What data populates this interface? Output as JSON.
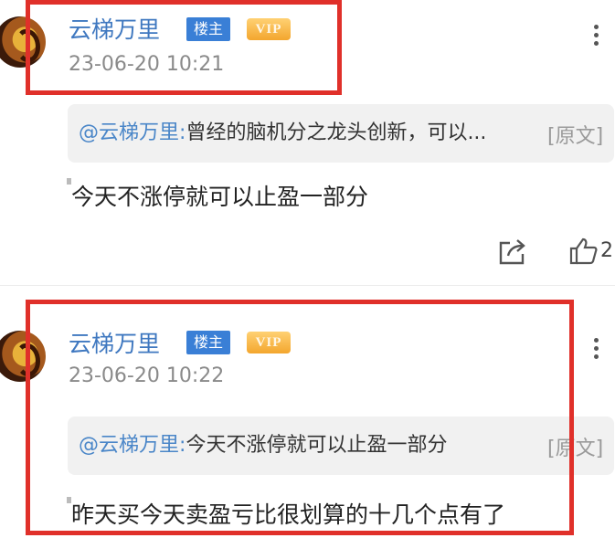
{
  "comments": [
    {
      "username": "云梯万里",
      "owner_tag": "楼主",
      "vip_tag": "VIP",
      "timestamp": "23-06-20 10:21",
      "quote_author": "@云梯万里",
      "quote_colon": ":",
      "quote_text": "曾经的脑机分之龙头创新，可以...",
      "original_label": "[原文]",
      "body": "今天不涨停就可以止盈一部分",
      "like_count": "2"
    },
    {
      "username": "云梯万里",
      "owner_tag": "楼主",
      "vip_tag": "VIP",
      "timestamp": "23-06-20 10:22",
      "quote_author": "@云梯万里",
      "quote_colon": ":",
      "quote_text": "今天不涨停就可以止盈一部分",
      "original_label": "[原文]",
      "body": "昨天买今天卖盈亏比很划算的十几个点有了"
    }
  ],
  "colors": {
    "username": "#3f78c0",
    "owner_tag_bg": "#3a7fd6",
    "vip_tag_bg": "#f3a62e",
    "highlight": "#e0302a",
    "quote_bg": "#f1f1f1"
  },
  "icons": [
    "avatar",
    "more-icon",
    "share-icon",
    "thumbs-up-icon"
  ]
}
